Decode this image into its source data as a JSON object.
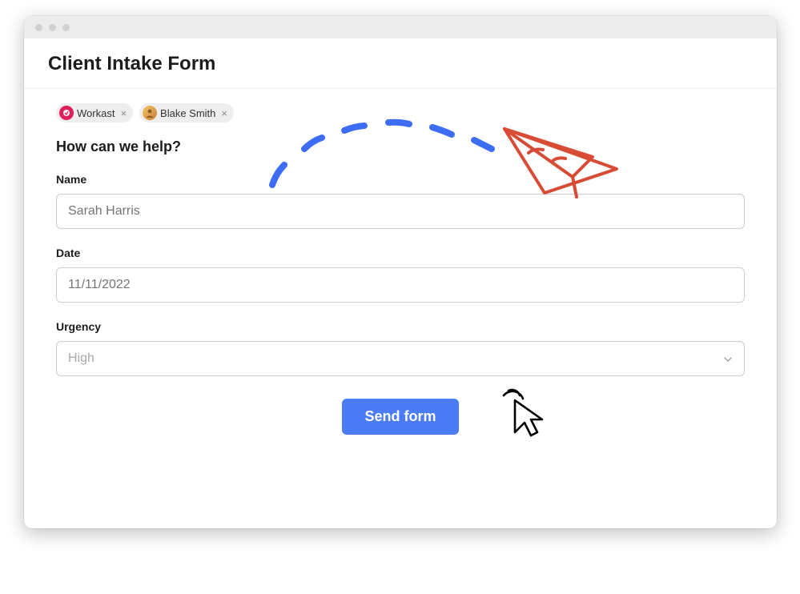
{
  "header": {
    "title": "Client Intake Form"
  },
  "chips": [
    {
      "label": "Workast",
      "icon": "app"
    },
    {
      "label": "Blake Smith",
      "icon": "user"
    }
  ],
  "question": "How can we help?",
  "fields": {
    "name": {
      "label": "Name",
      "placeholder": "Sarah Harris"
    },
    "date": {
      "label": "Date",
      "placeholder": "11/11/2022"
    },
    "urgency": {
      "label": "Urgency",
      "value": "High"
    }
  },
  "submit": {
    "label": "Send form"
  }
}
